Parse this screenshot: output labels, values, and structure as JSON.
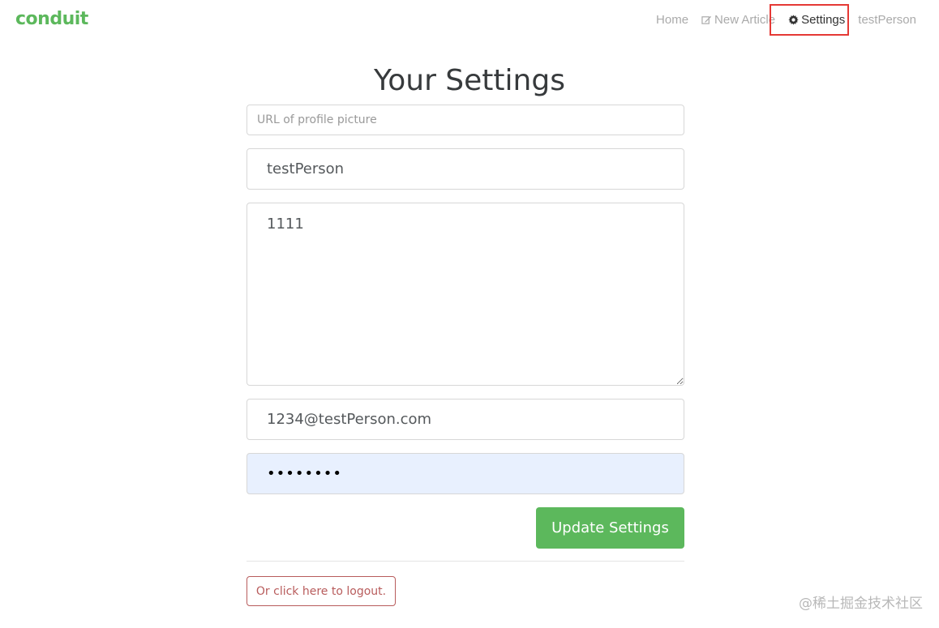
{
  "brand": "conduit",
  "nav": {
    "home": "Home",
    "new_article": "New Article",
    "settings": "Settings",
    "profile": "testPerson"
  },
  "title": "Your Settings",
  "form": {
    "image_placeholder": "URL of profile picture",
    "image_value": "",
    "username_value": "testPerson",
    "bio_value": "1111",
    "email_value": "1234@testPerson.com",
    "password_value": "12345678",
    "submit_label": "Update Settings"
  },
  "logout_label": "Or click here to logout.",
  "watermark": "@稀土掘金技术社区",
  "colors": {
    "brand": "#5cb85c",
    "danger": "#b85c5c",
    "highlight": "#e53935",
    "autofill": "#e8f0fe"
  }
}
